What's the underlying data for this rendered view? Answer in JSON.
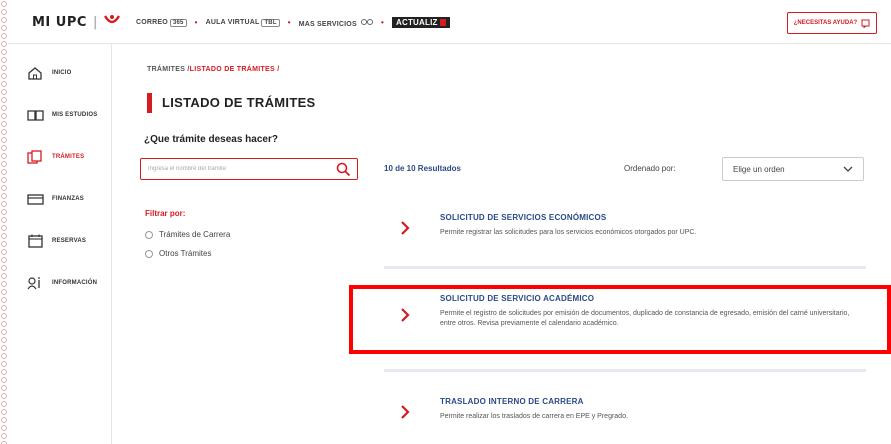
{
  "header": {
    "logo_text": "MI UPC",
    "logo_separator": "|",
    "nav": [
      {
        "label": "CORREO",
        "badge": "365"
      },
      {
        "label": "AULA VIRTUAL",
        "badge": "TBL"
      },
      {
        "label": "MAS SERVICIOS",
        "badge": ""
      }
    ],
    "actualizate_label": "ActUALIZ",
    "help_button_label": "¿NECESITAS AYUDA?"
  },
  "sidebar": {
    "items": [
      {
        "label": "INICIO",
        "icon": "home-icon",
        "active": false
      },
      {
        "label": "MIS ESTUDIOS",
        "icon": "book-icon",
        "active": false
      },
      {
        "label": "TRÁMITES",
        "icon": "documents-icon",
        "active": true
      },
      {
        "label": "FINANZAS",
        "icon": "wallet-icon",
        "active": false
      },
      {
        "label": "RESERVAS",
        "icon": "calendar-icon",
        "active": false
      },
      {
        "label": "INFORMACIÓN",
        "icon": "info-icon",
        "active": false
      }
    ]
  },
  "breadcrumb": {
    "root": "TRÁMITES /",
    "current": "LISTADO DE TRÁMITES /"
  },
  "page_title": "LISTADO DE TRÁMITES",
  "question": "¿Que trámite deseas hacer?",
  "search": {
    "placeholder": "Ingresa el nombre del trámite",
    "value": ""
  },
  "filters": {
    "title": "Filtrar por:",
    "options": [
      "Trámites de Carrera",
      "Otros Trámites"
    ]
  },
  "results_text": "10 de 10 Resultados",
  "order": {
    "label": "Ordenado por:",
    "selected": "Elige un orden"
  },
  "tramites": [
    {
      "title": "SOLICITUD DE SERVICIOS ECONÓMICOS",
      "description": "Permite registrar las solicitudes para los servicios económicos otorgados por UPC."
    },
    {
      "title": "SOLICITUD DE SERVICIO ACADÉMICO",
      "description": "Permite el registro de solicitudes por emisión de documentos, duplicado de constancia de egresado, emisión del carné universitario, entre otros. Revisa previamente el calendario académico."
    },
    {
      "title": "TRASLADO INTERNO DE CARRERA",
      "description": "Permite realizar los traslados de carrera en EPE y Pregrado."
    }
  ],
  "colors": {
    "accent_red": "#d71920",
    "link_blue": "#2a4a8a",
    "highlight_red": "#ff0000"
  }
}
